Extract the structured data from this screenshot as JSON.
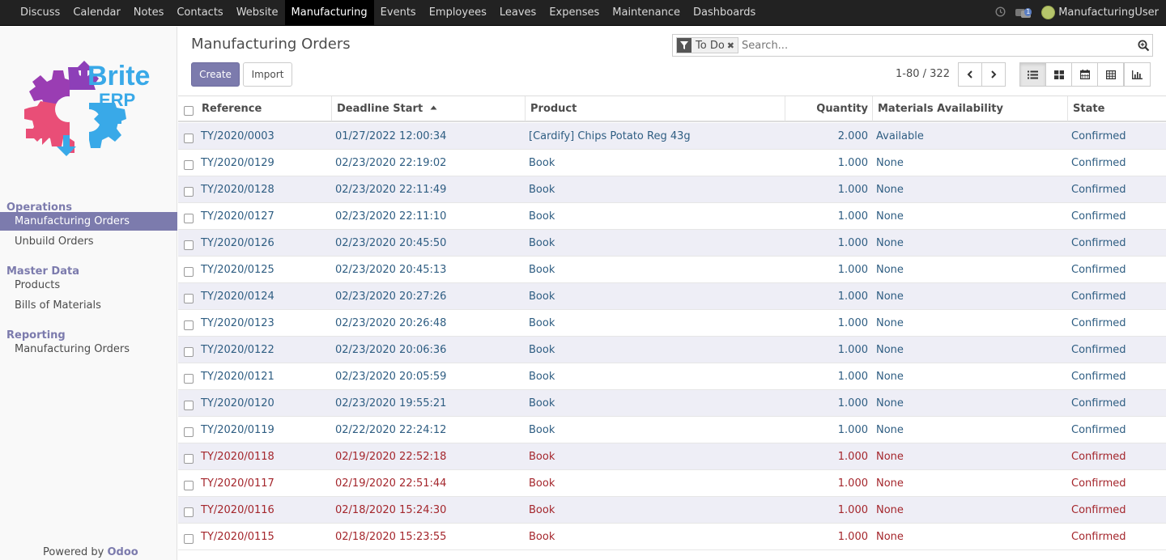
{
  "topbar": {
    "menu": [
      "Discuss",
      "Calendar",
      "Notes",
      "Contacts",
      "Website",
      "Manufacturing",
      "Events",
      "Employees",
      "Leaves",
      "Expenses",
      "Maintenance",
      "Dashboards"
    ],
    "active": "Manufacturing",
    "chat_count": "1",
    "user": "ManufacturingUser"
  },
  "logo": {
    "brand_line1": "Brite",
    "brand_line2": "ERP"
  },
  "sidebar": {
    "sections": [
      {
        "title": "Operations",
        "items": [
          "Manufacturing Orders",
          "Unbuild Orders"
        ]
      },
      {
        "title": "Master Data",
        "items": [
          "Products",
          "Bills of Materials"
        ]
      },
      {
        "title": "Reporting",
        "items": [
          "Manufacturing Orders"
        ]
      }
    ],
    "active_item": "Manufacturing Orders",
    "powered_prefix": "Powered by",
    "powered_brand": "Odoo"
  },
  "page": {
    "title": "Manufacturing Orders",
    "create_label": "Create",
    "import_label": "Import"
  },
  "search": {
    "facet": "To Do",
    "placeholder": "Search..."
  },
  "pager": {
    "value": "1-80 / 322"
  },
  "view_icons": [
    "list-view-icon",
    "kanban-view-icon",
    "calendar-view-icon",
    "pivot-view-icon",
    "graph-view-icon"
  ],
  "colors": {
    "accent": "#7c7bad",
    "link_blue": "#2e5d82",
    "overdue_red": "#a4262c",
    "topbar": "#222222"
  },
  "table": {
    "columns": [
      "Reference",
      "Deadline Start",
      "Product",
      "Quantity",
      "Materials Availability",
      "State"
    ],
    "sorted_column": "Deadline Start",
    "sort_direction": "ascending",
    "rows": [
      {
        "ref": "TY/2020/0003",
        "deadline": "01/27/2022 12:00:34",
        "product": "[Cardify] Chips Potato Reg 43g",
        "qty": "2.000",
        "avail": "Available",
        "state": "Confirmed",
        "late": false
      },
      {
        "ref": "TY/2020/0129",
        "deadline": "02/23/2020 22:19:02",
        "product": "Book",
        "qty": "1.000",
        "avail": "None",
        "state": "Confirmed",
        "late": false
      },
      {
        "ref": "TY/2020/0128",
        "deadline": "02/23/2020 22:11:49",
        "product": "Book",
        "qty": "1.000",
        "avail": "None",
        "state": "Confirmed",
        "late": false
      },
      {
        "ref": "TY/2020/0127",
        "deadline": "02/23/2020 22:11:10",
        "product": "Book",
        "qty": "1.000",
        "avail": "None",
        "state": "Confirmed",
        "late": false
      },
      {
        "ref": "TY/2020/0126",
        "deadline": "02/23/2020 20:45:50",
        "product": "Book",
        "qty": "1.000",
        "avail": "None",
        "state": "Confirmed",
        "late": false
      },
      {
        "ref": "TY/2020/0125",
        "deadline": "02/23/2020 20:45:13",
        "product": "Book",
        "qty": "1.000",
        "avail": "None",
        "state": "Confirmed",
        "late": false
      },
      {
        "ref": "TY/2020/0124",
        "deadline": "02/23/2020 20:27:26",
        "product": "Book",
        "qty": "1.000",
        "avail": "None",
        "state": "Confirmed",
        "late": false
      },
      {
        "ref": "TY/2020/0123",
        "deadline": "02/23/2020 20:26:48",
        "product": "Book",
        "qty": "1.000",
        "avail": "None",
        "state": "Confirmed",
        "late": false
      },
      {
        "ref": "TY/2020/0122",
        "deadline": "02/23/2020 20:06:36",
        "product": "Book",
        "qty": "1.000",
        "avail": "None",
        "state": "Confirmed",
        "late": false
      },
      {
        "ref": "TY/2020/0121",
        "deadline": "02/23/2020 20:05:59",
        "product": "Book",
        "qty": "1.000",
        "avail": "None",
        "state": "Confirmed",
        "late": false
      },
      {
        "ref": "TY/2020/0120",
        "deadline": "02/23/2020 19:55:21",
        "product": "Book",
        "qty": "1.000",
        "avail": "None",
        "state": "Confirmed",
        "late": false
      },
      {
        "ref": "TY/2020/0119",
        "deadline": "02/22/2020 22:24:12",
        "product": "Book",
        "qty": "1.000",
        "avail": "None",
        "state": "Confirmed",
        "late": false
      },
      {
        "ref": "TY/2020/0118",
        "deadline": "02/19/2020 22:52:18",
        "product": "Book",
        "qty": "1.000",
        "avail": "None",
        "state": "Confirmed",
        "late": true
      },
      {
        "ref": "TY/2020/0117",
        "deadline": "02/19/2020 22:51:44",
        "product": "Book",
        "qty": "1.000",
        "avail": "None",
        "state": "Confirmed",
        "late": true
      },
      {
        "ref": "TY/2020/0116",
        "deadline": "02/18/2020 15:24:30",
        "product": "Book",
        "qty": "1.000",
        "avail": "None",
        "state": "Confirmed",
        "late": true
      },
      {
        "ref": "TY/2020/0115",
        "deadline": "02/18/2020 15:23:55",
        "product": "Book",
        "qty": "1.000",
        "avail": "None",
        "state": "Confirmed",
        "late": true
      }
    ]
  }
}
